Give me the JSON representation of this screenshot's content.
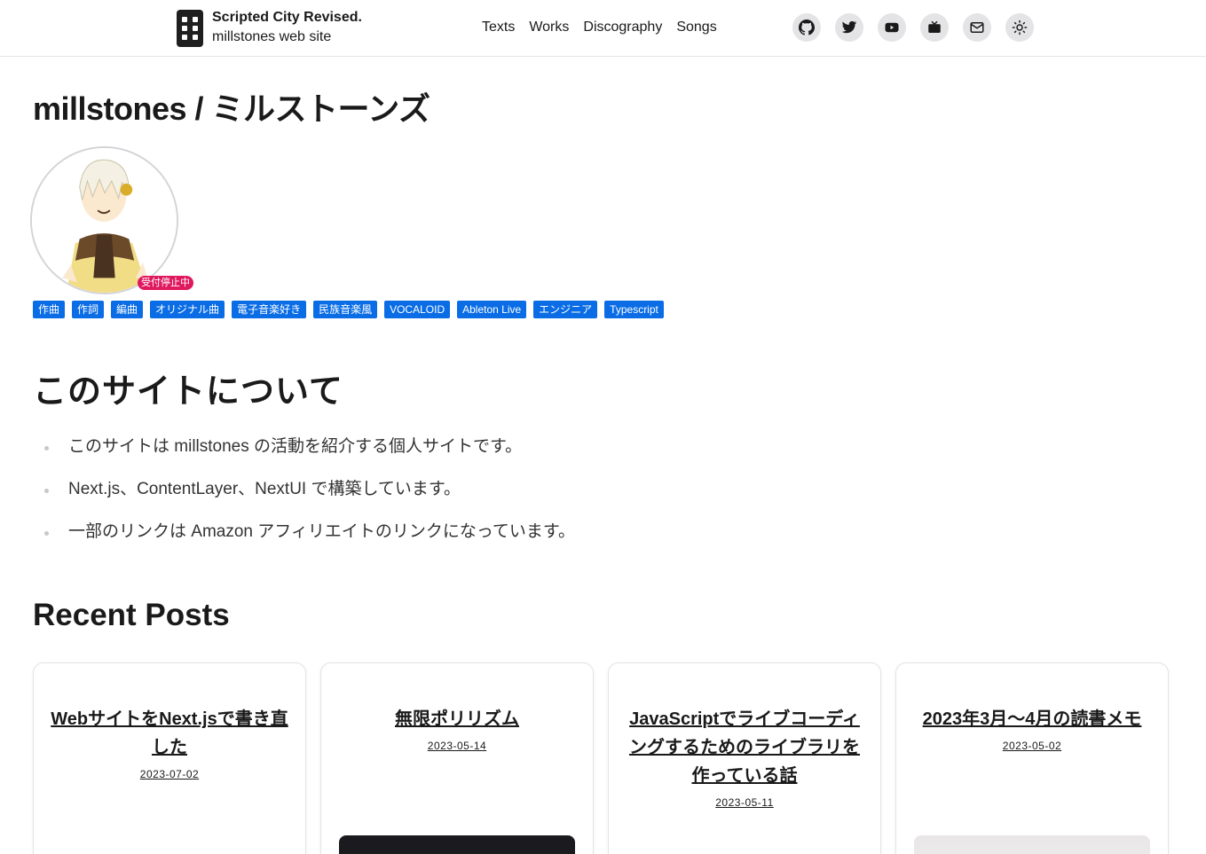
{
  "header": {
    "site_title": "Scripted City Revised.",
    "site_subtitle": "millstones web site",
    "nav": [
      "Texts",
      "Works",
      "Discography",
      "Songs"
    ],
    "icons": [
      "github-icon",
      "twitter-icon",
      "youtube-icon",
      "niconico-icon",
      "mail-icon",
      "sun-icon"
    ]
  },
  "profile": {
    "title": "millstones / ミルストーンズ",
    "badge": "受付停止中",
    "tags": [
      "作曲",
      "作詞",
      "編曲",
      "オリジナル曲",
      "電子音楽好き",
      "民族音楽風",
      "VOCALOID",
      "Ableton Live",
      "エンジニア",
      "Typescript"
    ]
  },
  "about": {
    "title": "このサイトについて",
    "items": [
      "このサイトは millstones の活動を紹介する個人サイトです。",
      "Next.js、ContentLayer、NextUI で構築しています。",
      "一部のリンクは Amazon アフィリエイトのリンクになっています。"
    ]
  },
  "recent": {
    "title": "Recent Posts",
    "posts": [
      {
        "title": "WebサイトをNext.jsで書き直した",
        "date": "2023-07-02"
      },
      {
        "title": "無限ポリリズム",
        "date": "2023-05-14"
      },
      {
        "title": "JavaScriptでライブコーディングするためのライブラリを作っている話",
        "date": "2023-05-11"
      },
      {
        "title": "2023年3月〜4月の読書メモ",
        "date": "2023-05-02"
      }
    ]
  },
  "colors": {
    "tag": "#0a6de6",
    "badge": "#e0185e",
    "icon_bg": "#e4e4e7"
  }
}
